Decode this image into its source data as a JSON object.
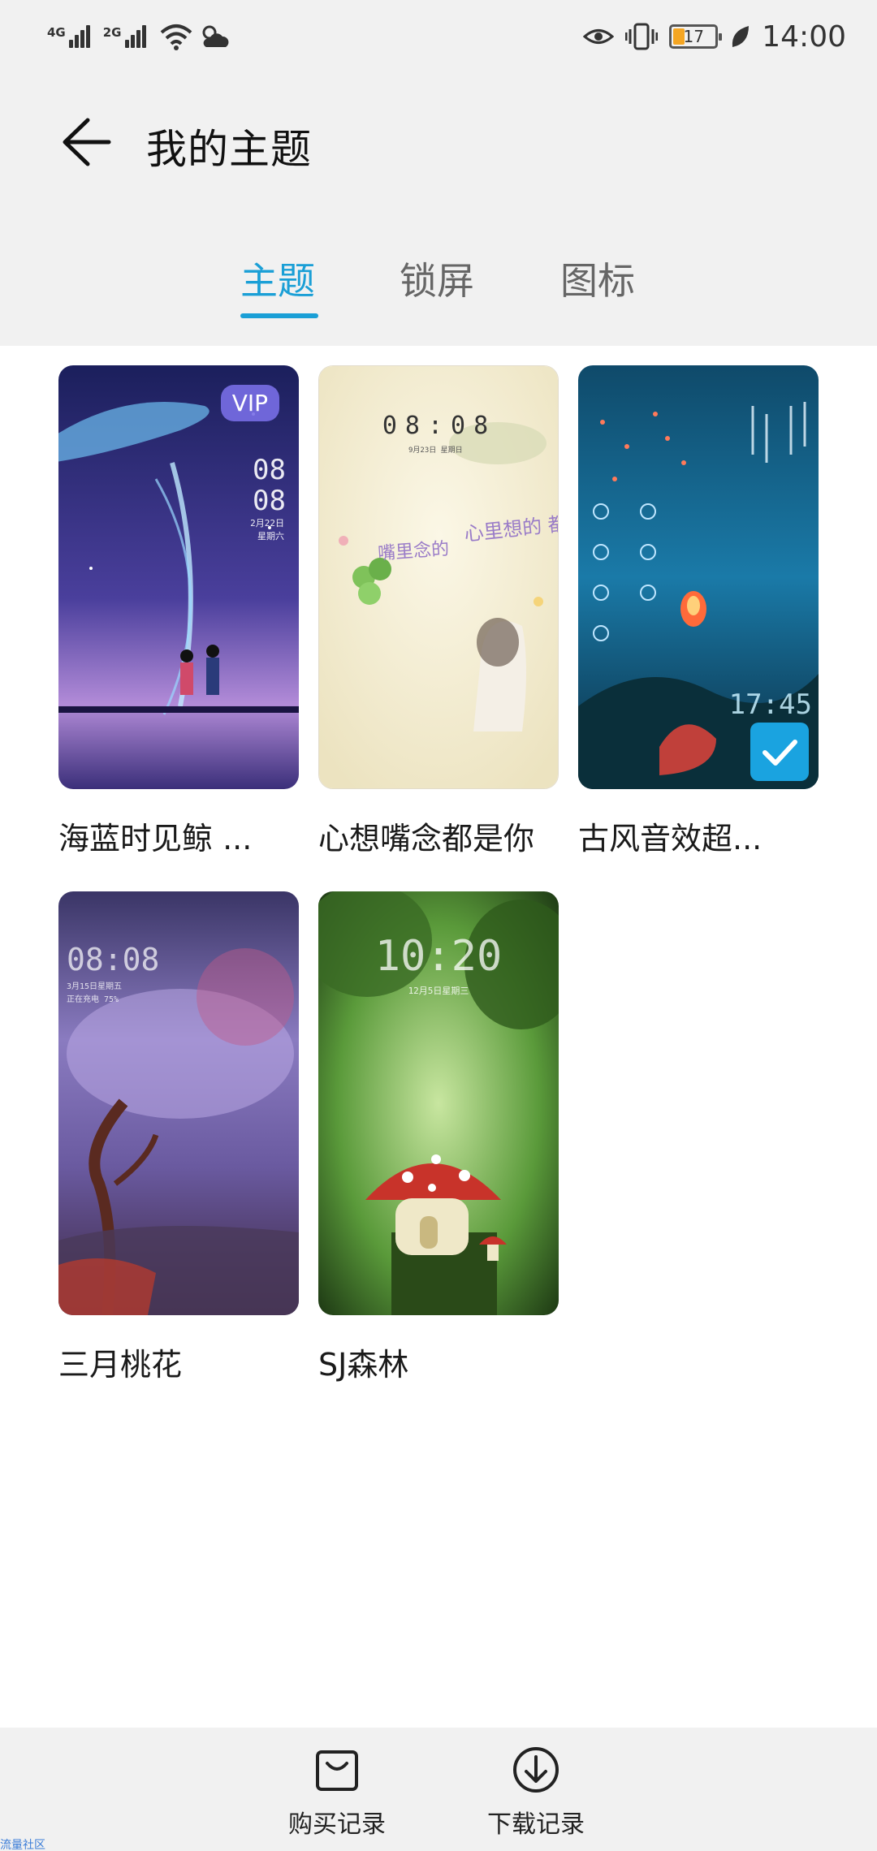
{
  "status_bar": {
    "network1": "4G",
    "network2": "2G",
    "battery": "17",
    "time": "14:00"
  },
  "header": {
    "title": "我的主题"
  },
  "tabs": [
    {
      "label": "主题",
      "active": true
    },
    {
      "label": "锁屏",
      "active": false
    },
    {
      "label": "图标",
      "active": false
    }
  ],
  "themes": [
    {
      "name": "海蓝时见鲸 ...",
      "badge": "VIP",
      "lock_time": "08\n08",
      "lock_date": "2月22日 星期六"
    },
    {
      "name": "心想嘴念都是你",
      "lock_time": "08:08",
      "lock_date": "9月23日 星期日",
      "poem1": "心里想的 都是你",
      "poem2": "嘴里念的"
    },
    {
      "name": "古风音效超...",
      "lock_time": "17:45",
      "selected": true
    },
    {
      "name": "三月桃花",
      "lock_time": "08:08",
      "lock_date": "3月15日星期五",
      "lock_extra": "正在充电 75%"
    },
    {
      "name": "SJ森林",
      "lock_time": "10:20",
      "lock_date": "12月5日星期三"
    }
  ],
  "bottom_bar": {
    "purchase_label": "购买记录",
    "download_label": "下载记录"
  },
  "watermark": "流量社区",
  "colors": {
    "accent": "#1a9fd6",
    "header_bg": "#f1f1f1",
    "selected_check": "#1aa3e0"
  }
}
